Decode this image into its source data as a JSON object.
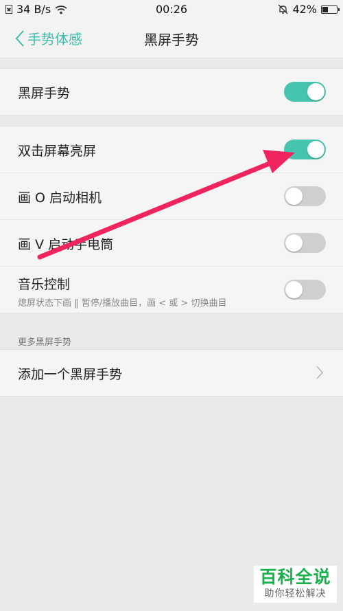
{
  "status_bar": {
    "network_speed": "34 B/s",
    "time": "00:26",
    "battery": "42%",
    "battery_level": 0.42
  },
  "header": {
    "back_label": "手势体感",
    "title": "黑屏手势"
  },
  "group1": {
    "items": [
      {
        "label": "黑屏手势",
        "toggle_on": true
      }
    ]
  },
  "group2": {
    "items": [
      {
        "label": "双击屏幕亮屏",
        "toggle_on": true
      },
      {
        "label": "画 O 启动相机",
        "toggle_on": false
      },
      {
        "label": "画 V 启动手电筒",
        "toggle_on": false
      },
      {
        "label": "音乐控制",
        "sublabel": "熄屏状态下画 ‖ 暂停/播放曲目，画 < 或 > 切换曲目",
        "toggle_on": false
      }
    ]
  },
  "more_section": {
    "caption": "更多黑屏手势",
    "add_label": "添加一个黑屏手势"
  },
  "watermark": {
    "title": "百科全说",
    "subtitle": "助你轻松解决"
  },
  "colors": {
    "accent": "#47c4ae",
    "annotation_arrow": "#f0245e",
    "watermark_green": "#1ab04c"
  }
}
